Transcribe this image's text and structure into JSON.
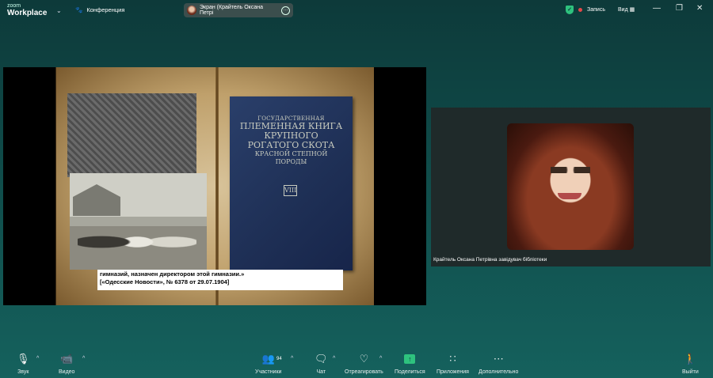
{
  "app": {
    "logo_line1": "zoom",
    "logo_line2": "Workplace"
  },
  "topbar": {
    "conference_label": "Конференция",
    "screen_share_label": "Экран (Крайтель Оксана Петрі",
    "record_label": "Запись",
    "view_label": "Вид"
  },
  "slide": {
    "cover_line1": "ГОСУДАРСТВЕННАЯ",
    "cover_line2": "ПЛЕМЕННАЯ КНИГА",
    "cover_line3": "КРУПНОГО",
    "cover_line4": "РОГАТОГО СКОТА",
    "cover_line5": "КРАСНОЙ СТЕПНОЙ",
    "cover_line6": "ПОРОДЫ",
    "volume": "VIII",
    "caption_line1": "гимназий, назначен директором этой гимназии.»",
    "caption_line2": "[«Одесские Новости», № 6378 от 29.07.1904]"
  },
  "participant": {
    "name": "Крайтель Оксана Петрівна завідувач бібліотеки"
  },
  "toolbar": {
    "mute": "Звук",
    "video": "Видео",
    "participants": "Участники",
    "participants_count": "94",
    "chat": "Чат",
    "react": "Отреагировать",
    "share": "Поделиться",
    "apps": "Приложения",
    "more": "Дополнительно",
    "leave": "Выйти"
  },
  "colors": {
    "accent_green": "#2ec27e",
    "record_red": "#e54848",
    "bg": "#0f4a48"
  }
}
